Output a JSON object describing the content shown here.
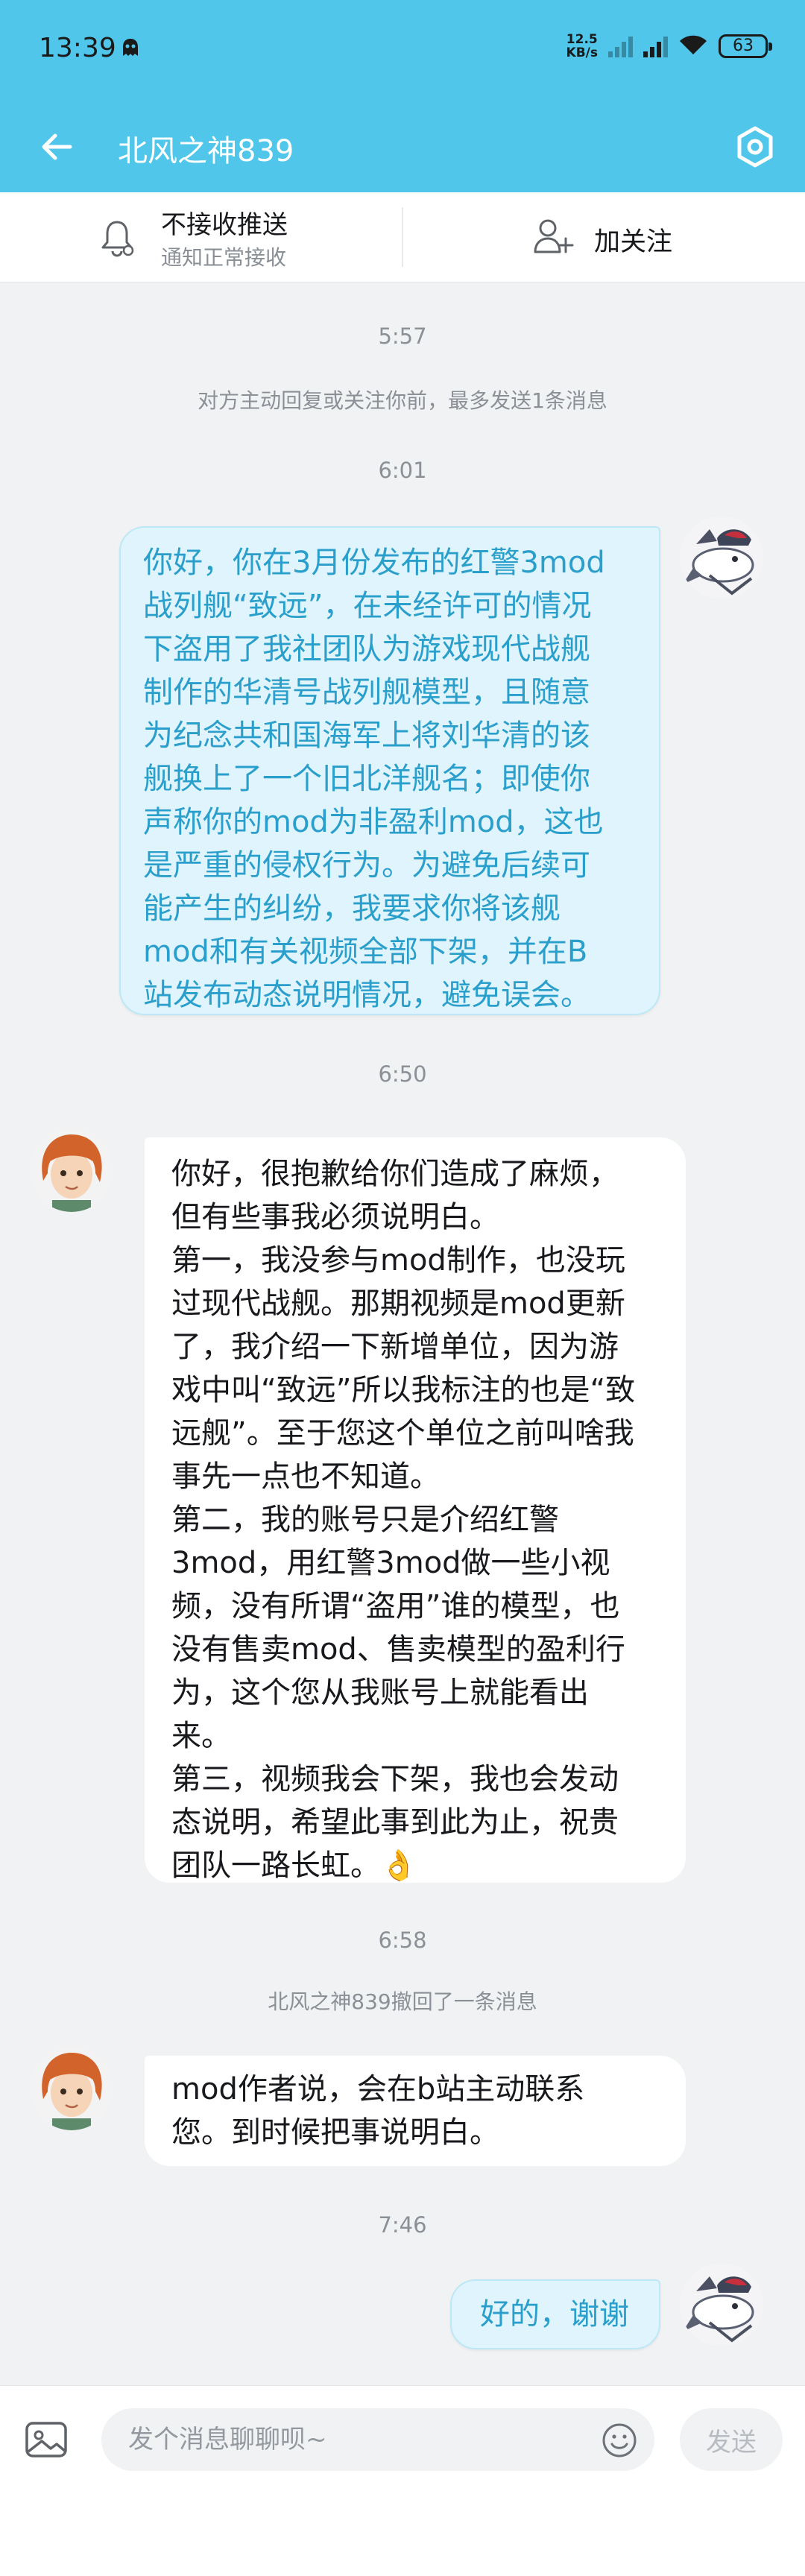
{
  "status_bar": {
    "time": "13:39",
    "net_speed_value": "12.5",
    "net_speed_unit": "KB/s",
    "battery": "63",
    "icons": [
      "ghost-icon",
      "signal-icon",
      "signal-icon",
      "wifi-icon",
      "battery-icon"
    ]
  },
  "header": {
    "title": "北风之神839",
    "accent_color": "#4fc6ea",
    "icons": [
      "back-arrow-icon",
      "settings-gear-icon"
    ]
  },
  "actions": {
    "push_title": "不接收推送",
    "push_subtitle": "通知正常接收",
    "follow_label": "加关注",
    "icons": [
      "bell-icon",
      "add-user-icon"
    ]
  },
  "chat": {
    "ts1": "5:57",
    "sys1": "对方主动回复或关注你前，最多发送1条消息",
    "ts2": "6:01",
    "msg1": "你好，你在3月份发布的红警3mod\n战列舰“致远”，在未经许可的情况\n下盗用了我社团队为游戏现代战舰\n制作的华清号战列舰模型，且随意\n为纪念共和国海军上将刘华清的该\n舰换上了一个旧北洋舰名；即使你\n声称你的mod为非盈利mod，这也\n是严重的侵权行为。为避免后续可\n能产生的纠纷，我要求你将该舰\nmod和有关视频全部下架，并在B\n站发布动态说明情况，避免误会。",
    "ts3": "6:50",
    "msg2": "你好，很抱歉给你们造成了麻烦，\n但有些事我必须说明白。\n第一，我没参与mod制作，也没玩\n过现代战舰。那期视频是mod更新\n了，我介绍一下新增单位，因为游\n戏中叫“致远”所以我标注的也是“致\n远舰”。至于您这个单位之前叫啥我\n事先一点也不知道。\n第二，我的账号只是介绍红警\n3mod，用红警3mod做一些小视\n频，没有所谓“盗用”谁的模型，也\n没有售卖mod、售卖模型的盈利行\n为，这个您从我账号上就能看出\n来。\n第三，视频我会下架，我也会发动\n态说明，希望此事到此为止，祝贵\n团队一路长虹。👌",
    "ts4": "6:58",
    "sys2": "北风之神839撤回了一条消息",
    "msg3": "mod作者说，会在b站主动联系\n您。到时候把事说明白。",
    "ts5": "7:46",
    "msg4": "好的，谢谢",
    "avatars": [
      "self-avatar-icon",
      "contact-avatar-icon"
    ]
  },
  "input_bar": {
    "placeholder": "发个消息聊聊呗~",
    "send_label": "发送",
    "icons": [
      "image-icon",
      "emoji-icon"
    ]
  }
}
